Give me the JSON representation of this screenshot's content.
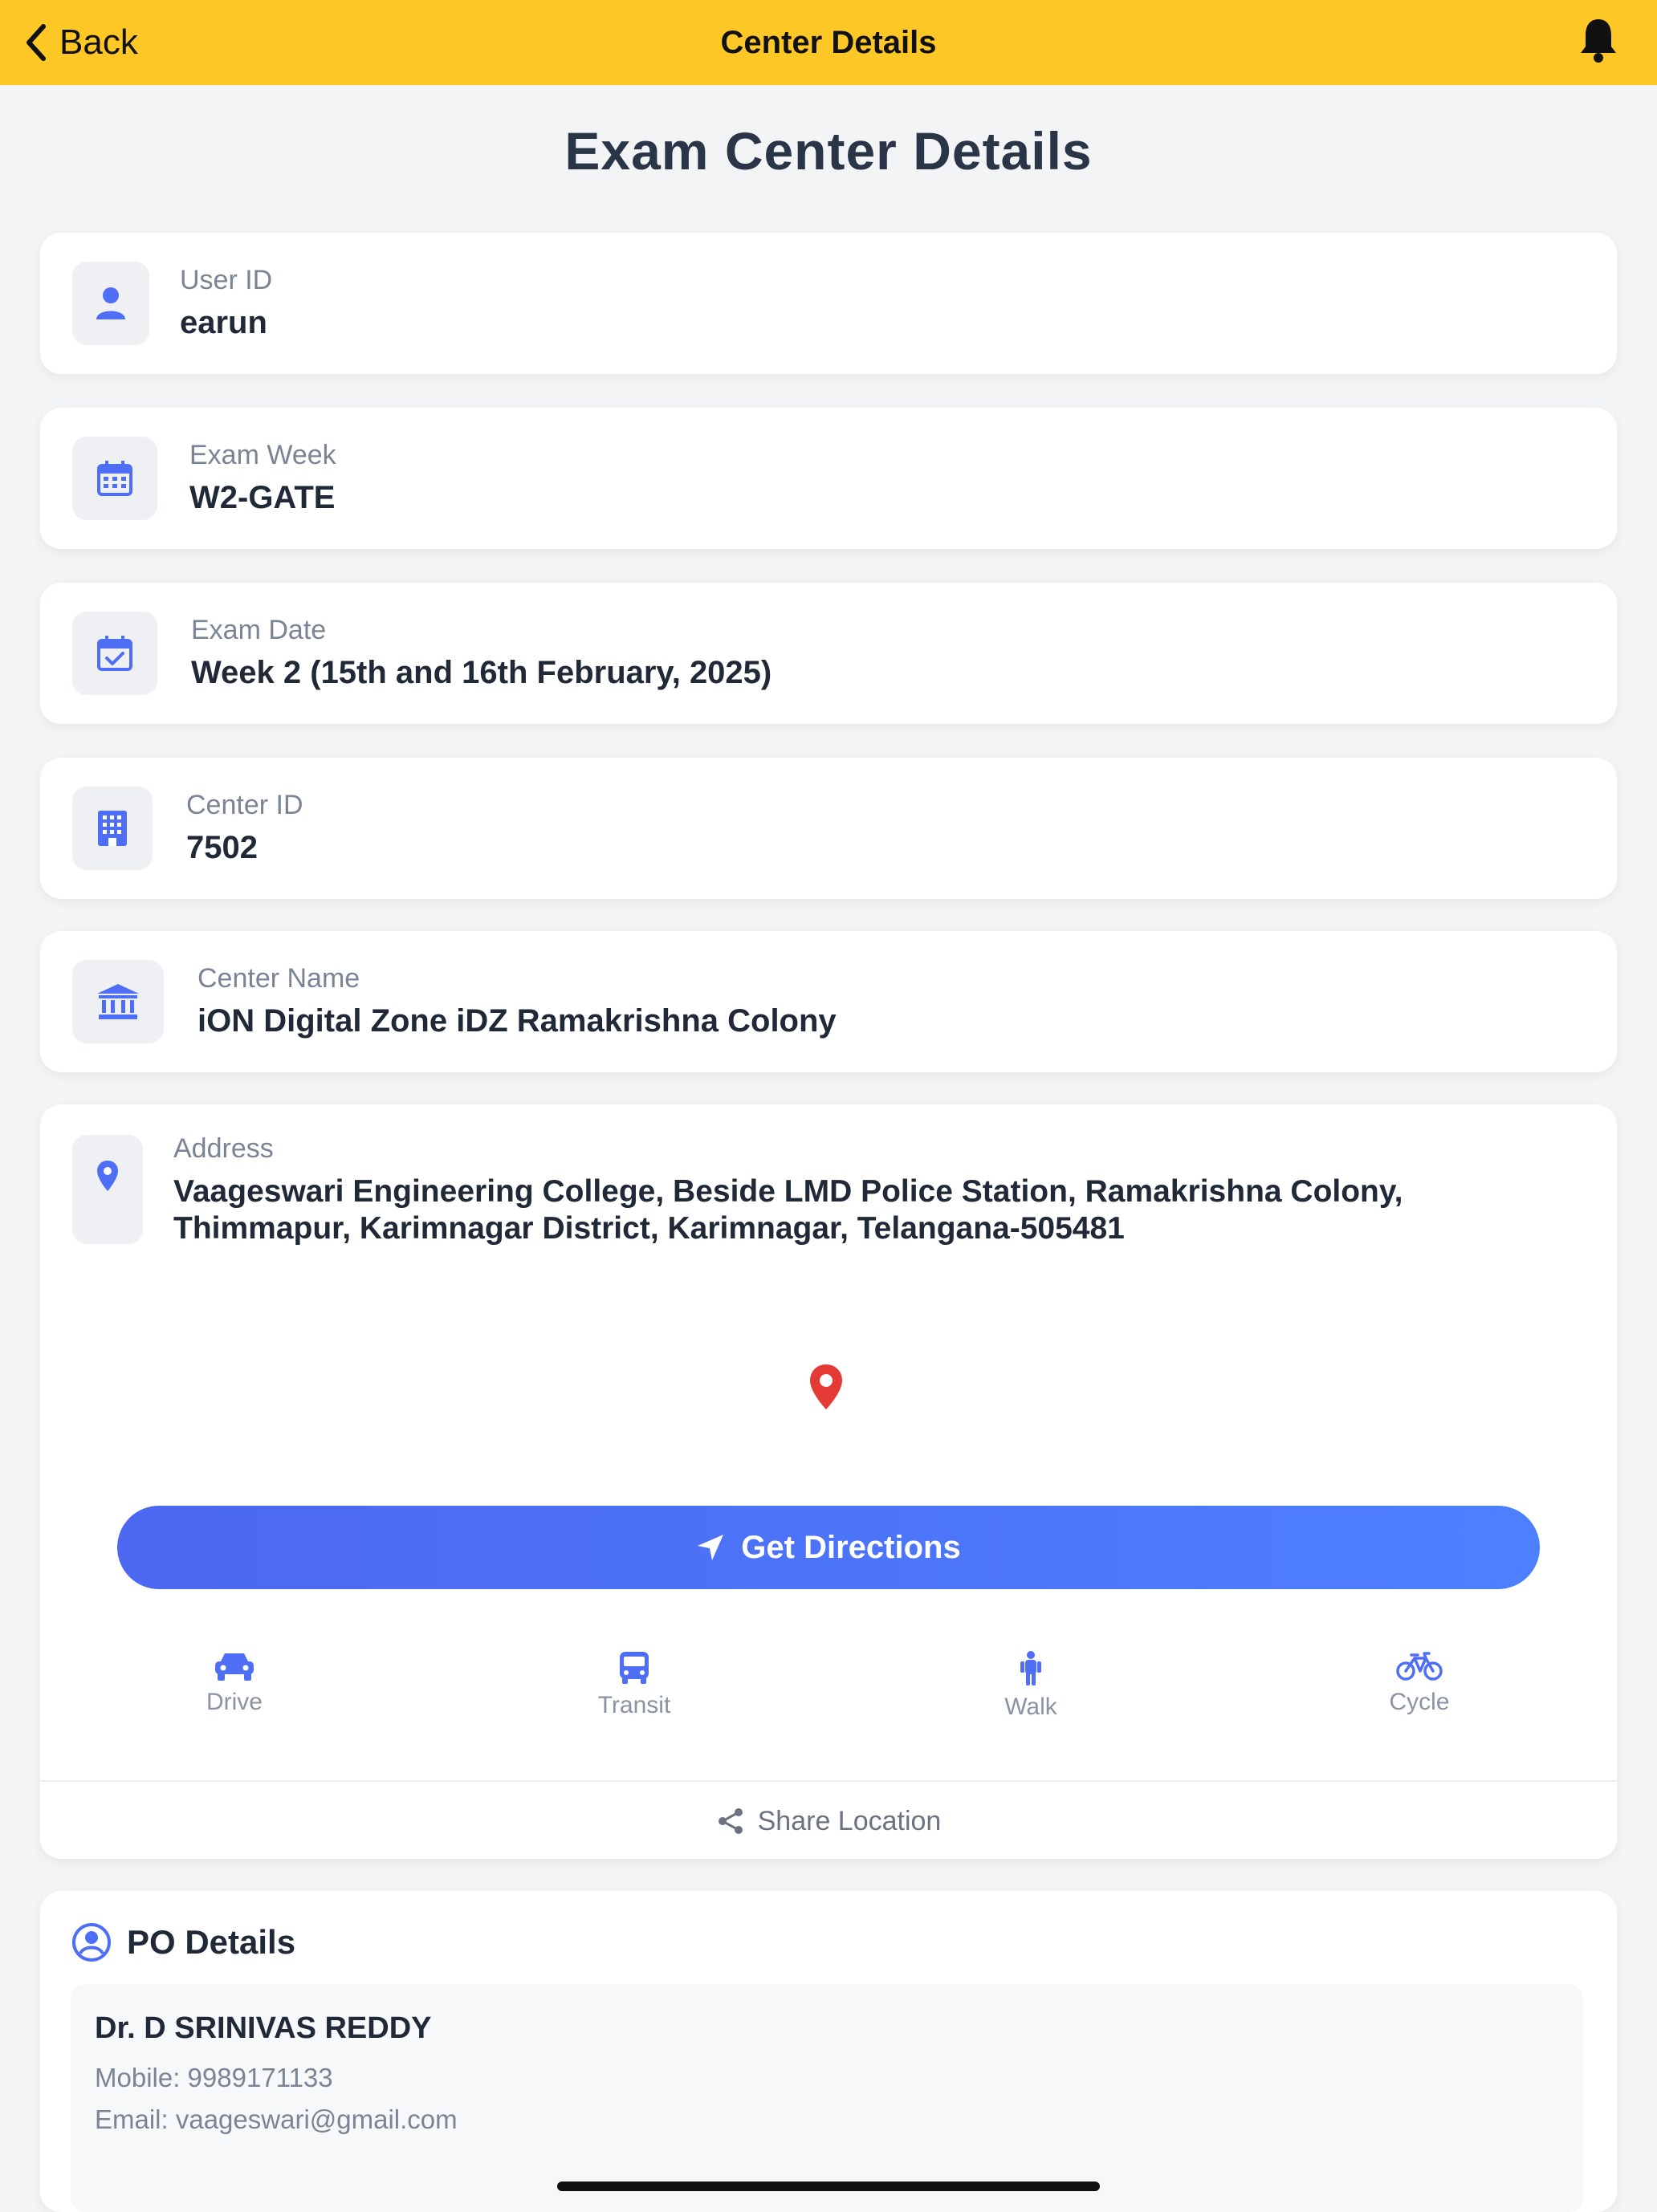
{
  "nav": {
    "back_label": "Back",
    "title": "Center Details"
  },
  "page_title": "Exam Center Details",
  "fields": [
    {
      "label": "User ID",
      "value": "earun",
      "icon": "user-icon"
    },
    {
      "label": "Exam Week",
      "value": "W2-GATE",
      "icon": "calendar-icon"
    },
    {
      "label": "Exam Date",
      "value": "Week 2 (15th and 16th February, 2025)",
      "icon": "calendar-check-icon"
    },
    {
      "label": "Center ID",
      "value": "7502",
      "icon": "building-icon"
    },
    {
      "label": "Center Name",
      "value": "iON Digital Zone iDZ Ramakrishna Colony",
      "icon": "institution-icon"
    }
  ],
  "address": {
    "label": "Address",
    "value": "Vaageswari Engineering College, Beside LMD Police Station, Ramakrishna Colony, Thimmapur, Karimnagar District, Karimnagar, Telangana-505481"
  },
  "directions": {
    "button_label": "Get Directions",
    "modes": [
      {
        "label": "Drive",
        "icon": "car-icon"
      },
      {
        "label": "Transit",
        "icon": "bus-icon"
      },
      {
        "label": "Walk",
        "icon": "walk-icon"
      },
      {
        "label": "Cycle",
        "icon": "bicycle-icon"
      }
    ],
    "share_label": "Share Location"
  },
  "po": {
    "heading": "PO Details",
    "name": "Dr. D SRINIVAS REDDY",
    "mobile": "Mobile: 9989171133",
    "email": "Email: vaageswari@gmail.com"
  },
  "colors": {
    "header": "#fdc825",
    "accent": "#4d6ef5",
    "pin": "#e53935",
    "icon_blue": "#4d6ef5"
  }
}
